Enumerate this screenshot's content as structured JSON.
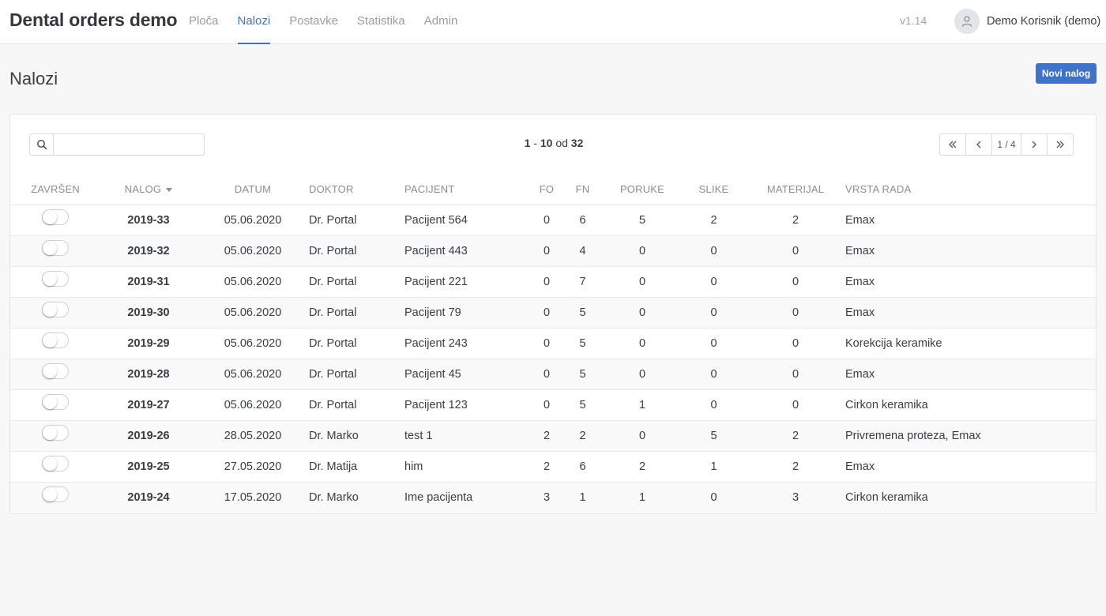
{
  "app": {
    "title": "Dental orders demo",
    "version": "v1.14",
    "user": "Demo Korisnik (demo)",
    "accent": "#3f72c9"
  },
  "nav": [
    {
      "label": "Ploča",
      "active": false
    },
    {
      "label": "Nalozi",
      "active": true
    },
    {
      "label": "Postavke",
      "active": false
    },
    {
      "label": "Statistika",
      "active": false
    },
    {
      "label": "Admin",
      "active": false
    }
  ],
  "page": {
    "title": "Nalozi",
    "new_button": "Novi nalog"
  },
  "search": {
    "value": "",
    "placeholder": ""
  },
  "range": {
    "from": "1",
    "sep": " - ",
    "to": "10",
    "of": " od ",
    "total": "32"
  },
  "pager": {
    "first": "«",
    "prev": "‹",
    "info": "1 / 4",
    "next": "›",
    "last": "»"
  },
  "columns": [
    "ZAVRŠEN",
    "NALOG",
    "DATUM",
    "DOKTOR",
    "PACIJENT",
    "FO",
    "FN",
    "PORUKE",
    "SLIKE",
    "MATERIJAL",
    "VRSTA RADA"
  ],
  "sort_column": "NALOG",
  "rows": [
    {
      "done": false,
      "nalog": "2019-33",
      "datum": "05.06.2020",
      "doktor": "Dr. Portal",
      "pacijent": "Pacijent 564",
      "fo": "0",
      "fn": "6",
      "poruke": "5",
      "slike": "2",
      "materijal": "2",
      "vrsta": "Emax"
    },
    {
      "done": false,
      "nalog": "2019-32",
      "datum": "05.06.2020",
      "doktor": "Dr. Portal",
      "pacijent": "Pacijent 443",
      "fo": "0",
      "fn": "4",
      "poruke": "0",
      "slike": "0",
      "materijal": "0",
      "vrsta": "Emax"
    },
    {
      "done": false,
      "nalog": "2019-31",
      "datum": "05.06.2020",
      "doktor": "Dr. Portal",
      "pacijent": "Pacijent 221",
      "fo": "0",
      "fn": "7",
      "poruke": "0",
      "slike": "0",
      "materijal": "0",
      "vrsta": "Emax"
    },
    {
      "done": false,
      "nalog": "2019-30",
      "datum": "05.06.2020",
      "doktor": "Dr. Portal",
      "pacijent": "Pacijent 79",
      "fo": "0",
      "fn": "5",
      "poruke": "0",
      "slike": "0",
      "materijal": "0",
      "vrsta": "Emax"
    },
    {
      "done": false,
      "nalog": "2019-29",
      "datum": "05.06.2020",
      "doktor": "Dr. Portal",
      "pacijent": "Pacijent 243",
      "fo": "0",
      "fn": "5",
      "poruke": "0",
      "slike": "0",
      "materijal": "0",
      "vrsta": "Korekcija keramike"
    },
    {
      "done": false,
      "nalog": "2019-28",
      "datum": "05.06.2020",
      "doktor": "Dr. Portal",
      "pacijent": "Pacijent 45",
      "fo": "0",
      "fn": "5",
      "poruke": "0",
      "slike": "0",
      "materijal": "0",
      "vrsta": "Emax"
    },
    {
      "done": false,
      "nalog": "2019-27",
      "datum": "05.06.2020",
      "doktor": "Dr. Portal",
      "pacijent": "Pacijent 123",
      "fo": "0",
      "fn": "5",
      "poruke": "1",
      "slike": "0",
      "materijal": "0",
      "vrsta": "Cirkon keramika"
    },
    {
      "done": false,
      "nalog": "2019-26",
      "datum": "28.05.2020",
      "doktor": "Dr. Marko",
      "pacijent": "test 1",
      "fo": "2",
      "fn": "2",
      "poruke": "0",
      "slike": "5",
      "materijal": "2",
      "vrsta": "Privremena proteza, Emax"
    },
    {
      "done": false,
      "nalog": "2019-25",
      "datum": "27.05.2020",
      "doktor": "Dr. Matija",
      "pacijent": "him",
      "fo": "2",
      "fn": "6",
      "poruke": "2",
      "slike": "1",
      "materijal": "2",
      "vrsta": "Emax"
    },
    {
      "done": false,
      "nalog": "2019-24",
      "datum": "17.05.2020",
      "doktor": "Dr. Marko",
      "pacijent": "Ime pacijenta",
      "fo": "3",
      "fn": "1",
      "poruke": "1",
      "slike": "0",
      "materijal": "3",
      "vrsta": "Cirkon keramika"
    }
  ]
}
